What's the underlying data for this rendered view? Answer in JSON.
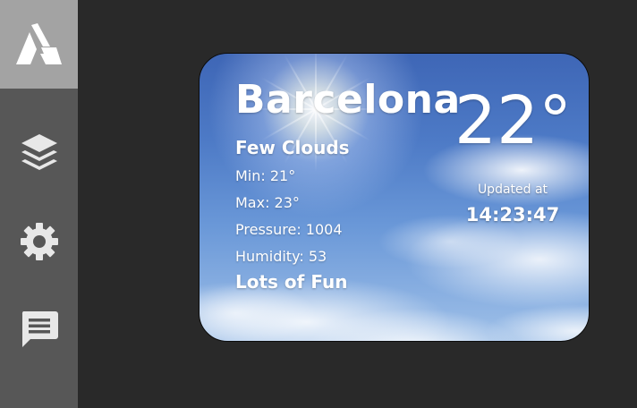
{
  "sidebar": {
    "items": [
      {
        "icon": "atlassian-logo-icon",
        "active": true
      },
      {
        "icon": "layers-icon",
        "active": false
      },
      {
        "icon": "gear-icon",
        "active": false
      },
      {
        "icon": "chat-message-icon",
        "active": false
      }
    ]
  },
  "weather": {
    "city": "Barcelona",
    "temperature": "22°",
    "description": "Few Clouds",
    "min": "Min: 21°",
    "max": "Max: 23°",
    "pressure": "Pressure: 1004",
    "humidity": "Humidity: 53",
    "tagline": "Lots of Fun",
    "updated_label": "Updated at",
    "updated_time": "14:23:47"
  },
  "colors": {
    "page_background": "#292929",
    "sidebar_background": "#575757",
    "sidebar_active": "#a3a3a3",
    "icon_color": "#e8e8e8",
    "text": "#ffffff"
  }
}
